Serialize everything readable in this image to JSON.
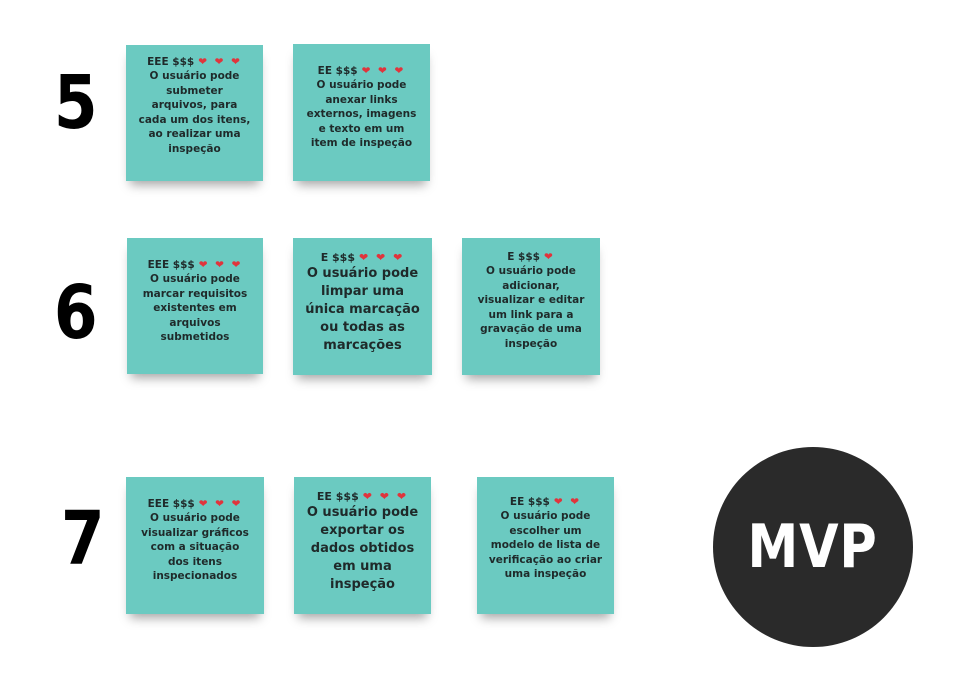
{
  "rows": [
    {
      "number": "5"
    },
    {
      "number": "6"
    },
    {
      "number": "7"
    }
  ],
  "notes": [
    {
      "effort": "EEE $$$",
      "hearts": "❤ ❤ ❤",
      "text": "O usuário pode\nsubmeter\narquivos, para\ncada um dos itens,\nao realizar uma\ninspeção"
    },
    {
      "effort": "EE $$$",
      "hearts": "❤ ❤ ❤",
      "text": "O usuário pode\nanexar links\nexternos, imagens\ne texto em um\nitem de  inspeção"
    },
    {
      "effort": "EEE $$$",
      "hearts": "❤ ❤ ❤",
      "text": "O usuário pode\nmarcar requisitos\nexistentes em\narquivos\nsubmetidos"
    },
    {
      "effort": "E $$$",
      "hearts": "❤ ❤ ❤",
      "text": "O usuário pode\nlimpar uma\núnica marcação\nou todas as\nmarcações"
    },
    {
      "effort": "E $$$",
      "hearts": "❤",
      "text": "O usuário pode\nadicionar,\nvisualizar e editar\num link para a\ngravação de uma\ninspeção"
    },
    {
      "effort": "EEE $$$",
      "hearts": "❤ ❤ ❤",
      "text": "O usuário pode\nvisualizar gráficos\ncom a  situação\ndos itens\ninspecionados"
    },
    {
      "effort": "EE $$$",
      "hearts": "❤ ❤ ❤",
      "text": "O usuário pode\nexportar os\ndados obtidos\nem uma\ninspeção"
    },
    {
      "effort": "EE $$$",
      "hearts": "❤ ❤",
      "text": "O usuário pode\nescolher um\nmodelo de lista de\nverificação ao criar\numa inspeção"
    }
  ],
  "badge": {
    "label": "MVP"
  }
}
